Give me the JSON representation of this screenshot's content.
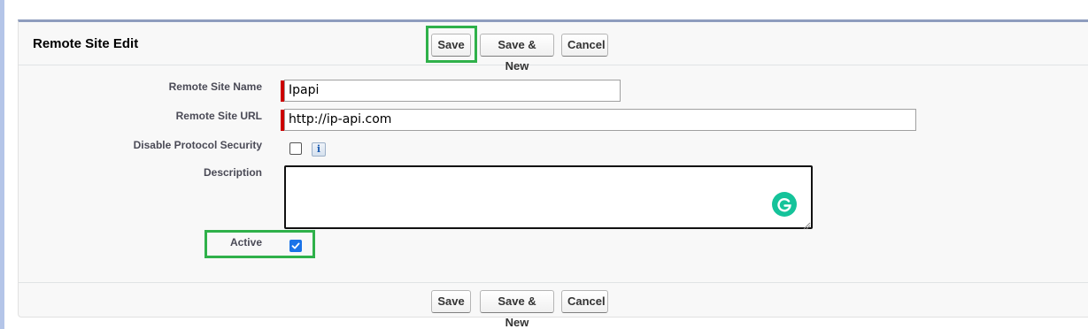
{
  "panel": {
    "title": "Remote Site Edit"
  },
  "buttons": {
    "save": "Save",
    "save_new": "Save & New",
    "cancel": "Cancel"
  },
  "fields": {
    "remote_site_name": {
      "label": "Remote Site Name",
      "value": "Ipapi",
      "required": true
    },
    "remote_site_url": {
      "label": "Remote Site URL",
      "value": "http://ip-api.com",
      "required": true
    },
    "disable_protocol_security": {
      "label": "Disable Protocol Security",
      "checked": false,
      "info_icon": "info-icon"
    },
    "description": {
      "label": "Description",
      "value": ""
    },
    "active": {
      "label": "Active",
      "checked": true
    }
  },
  "colors": {
    "panel_border_top": "#8e9dbe",
    "required_marker": "#cc0000",
    "highlight_box": "#2fb14a",
    "checkbox_checked": "#1a73e8",
    "grammarly": "#15c39a",
    "left_strip": "#b4c5e8"
  }
}
